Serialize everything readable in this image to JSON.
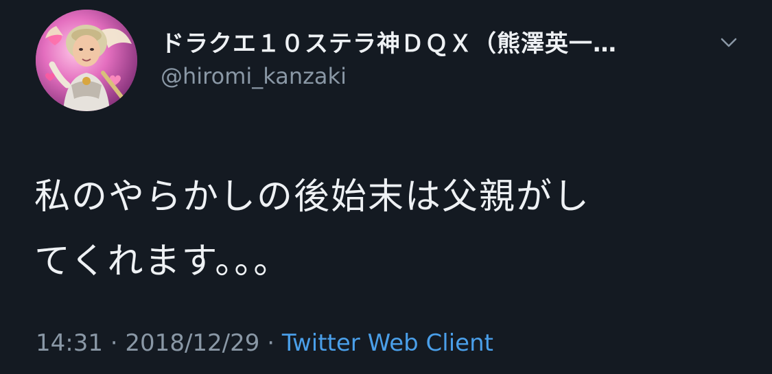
{
  "colors": {
    "background": "#141a22",
    "text": "#eef1f4",
    "muted": "#8a98a6",
    "link": "#4a9fe9"
  },
  "tweet": {
    "display_name": "ドラクエ１０ステラ神ＤＱＸ（熊澤英一…",
    "handle": "@hiromi_kanzaki",
    "text_lines": [
      "私のやらかしの後始末は父親がし",
      "てくれます。。。"
    ],
    "time": "14:31",
    "separator": " · ",
    "date": "2018/12/29",
    "client": "Twitter Web Client",
    "avatar_icon": "profile-avatar-image",
    "menu_icon": "chevron-down-icon"
  }
}
